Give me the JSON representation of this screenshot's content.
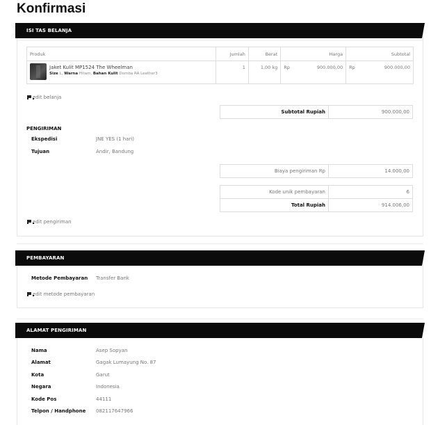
{
  "page": {
    "title": "Konfirmasi"
  },
  "cart": {
    "header": "ISI TAS BELANJA",
    "columns": {
      "product": "Produk",
      "qty": "Jumlah",
      "weight": "Berat",
      "price": "Harga",
      "subtotal": "Subtotal"
    },
    "row": {
      "name": "Jaket Kulit MP1524 The Wheelman",
      "size_label": "Size",
      "size_value": "L",
      "color_label": "Warna",
      "color_value": "Hitam",
      "material_label": "Bahan Kulit",
      "material_value": "Domba RA Leather3",
      "qty": "1",
      "weight": "1,00 kg",
      "price_currency": "Rp",
      "price": "900.000,00",
      "subtotal_currency": "Rp",
      "subtotal": "900.000,00"
    },
    "edit_link": "edit belanja",
    "subtotal_label": "Subtotal Rupiah",
    "subtotal_value": "900.000,00"
  },
  "shipping": {
    "label": "PENGIRIMAN",
    "expedition_label": "Ekspedisi",
    "expedition_value": "JNE YES (1 hari)",
    "destination_label": "Tujuan",
    "destination_value": "Andir, Bandung",
    "cost_label": "Biaya pengiriman  Rp",
    "cost_value": "14.000,00",
    "unique_label": "Kode unik pembayaran",
    "unique_value": "6",
    "total_label": "Total Rupiah",
    "total_value": "914.006,00",
    "edit_link": "edit pengiriman"
  },
  "payment": {
    "header": "PEMBAYARAN",
    "method_label": "Metode Pembayaran",
    "method_value": "Transfer Bank",
    "edit_link": "edit metode pembayaran"
  },
  "address": {
    "header": "ALAMAT PENGIRIMAN",
    "fields": [
      {
        "label": "Nama",
        "value": "Asep Sopyan"
      },
      {
        "label": "Alamat",
        "value": "Gagak Lumayung No. 87"
      },
      {
        "label": "Kota",
        "value": "Garut"
      },
      {
        "label": "Negara",
        "value": "Indonesia"
      },
      {
        "label": "Kode Pos",
        "value": "44111"
      },
      {
        "label": "Telpon / Handphone",
        "value": "082117647966"
      }
    ]
  }
}
